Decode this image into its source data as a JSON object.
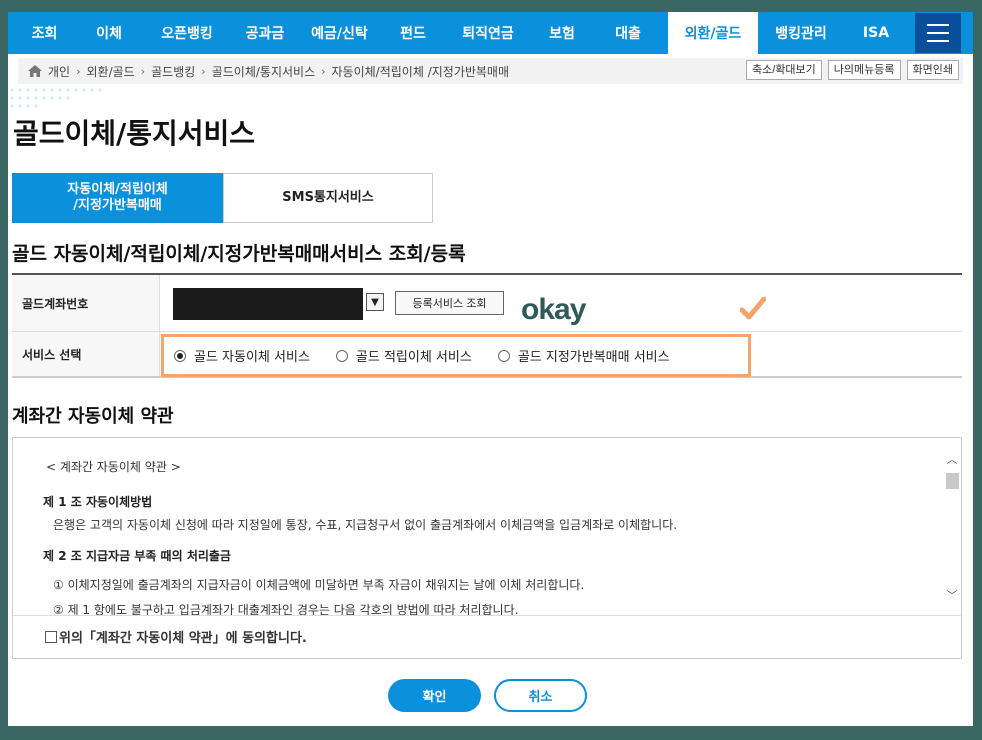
{
  "nav": {
    "items": [
      {
        "label": "조회"
      },
      {
        "label": "이체"
      },
      {
        "label": "오픈뱅킹"
      },
      {
        "label": "공과금"
      },
      {
        "label": "예금/신탁"
      },
      {
        "label": "펀드"
      },
      {
        "label": "퇴직연금"
      },
      {
        "label": "보험"
      },
      {
        "label": "대출"
      },
      {
        "label": "외환/골드"
      },
      {
        "label": "뱅킹관리"
      },
      {
        "label": "ISA"
      }
    ],
    "active": "외환/골드",
    "menu_icon": "hamburger-icon"
  },
  "breadcrumb": {
    "items": [
      "개인",
      "외환/골드",
      "골드뱅킹",
      "골드이체/통지서비스",
      "자동이체/적립이체 /지정가반복매매"
    ],
    "tools": [
      "축소/확대보기",
      "나의메뉴등록",
      "화면인쇄"
    ]
  },
  "page": {
    "title": "골드이체/통지서비스",
    "tabs": [
      "자동이체/적립이체\n/지정가반복매매",
      "SMS통지서비스"
    ],
    "section_title": "골드 자동이체/적립이체/지정가반복매매서비스 조회/등록"
  },
  "form": {
    "account_label": "골드계좌번호",
    "lookup_button": "등록서비스 조회",
    "okay_text": "okay",
    "service_label": "서비스 선택",
    "services": [
      "골드 자동이체 서비스",
      "골드 적립이체 서비스",
      "골드 지정가반복매매 서비스"
    ],
    "selected_service": "골드 자동이체 서비스"
  },
  "terms": {
    "title": "계좌간 자동이체 약관",
    "header": "< 계좌간 자동이체 약관 >",
    "article1_title": "제 1 조 자동이체방법",
    "article1_body": "은행은 고객의 자동이체 신청에 따라 지정일에 통장, 수표, 지급청구서 없이 출금계좌에서 이체금액을 입금계좌로 이체합니다.",
    "article2_title": "제 2 조 지급자금 부족 때의 처리출금",
    "article2_item1": "① 이체지정일에 출금계좌의 지급자금이 이체금액에 미달하면 부족 자금이 채워지는 날에 이체 처리합니다.",
    "article2_item2": "② 제 1 항에도 불구하고 입금계좌가 대출계좌인 경우는 다음 각호의 방법에 따라 처리합니다.",
    "agree_text": "위의「계좌간 자동이체 약관」에 동의합니다."
  },
  "actions": {
    "confirm": "확인",
    "cancel": "취소"
  },
  "colors": {
    "brand": "#0b90dc",
    "highlight_border": "#f4a46a",
    "okay_text": "#2f5a5a"
  }
}
